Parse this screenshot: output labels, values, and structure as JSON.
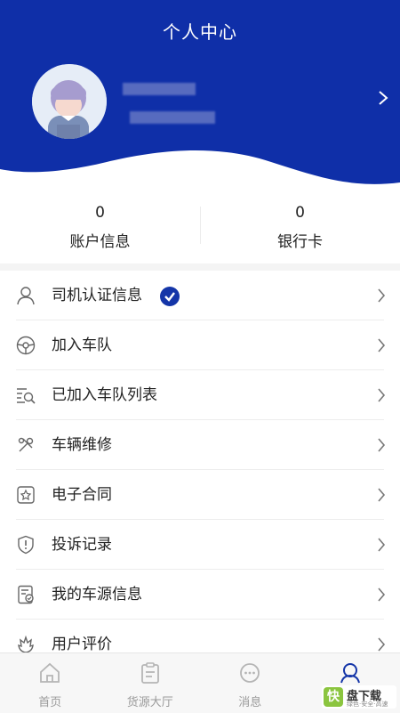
{
  "header": {
    "title": "个人中心",
    "background_color": "#0f2fa8",
    "chevron_icon": "chevron-right-icon"
  },
  "stats": [
    {
      "value": "0",
      "label": "账户信息"
    },
    {
      "value": "0",
      "label": "银行卡"
    }
  ],
  "menu": [
    {
      "label": "司机认证信息",
      "icon": "user-icon",
      "verified": true
    },
    {
      "label": "加入车队",
      "icon": "steering-wheel-icon"
    },
    {
      "label": "已加入车队列表",
      "icon": "list-search-icon"
    },
    {
      "label": "车辆维修",
      "icon": "wrench-icon"
    },
    {
      "label": "电子合同",
      "icon": "contract-icon"
    },
    {
      "label": "投诉记录",
      "icon": "shield-alert-icon"
    },
    {
      "label": "我的车源信息",
      "icon": "document-check-icon"
    },
    {
      "label": "用户评价",
      "icon": "flower-icon"
    }
  ],
  "tabbar": [
    {
      "label": "首页",
      "icon": "home-icon",
      "active": false
    },
    {
      "label": "货源大厅",
      "icon": "clipboard-icon",
      "active": false
    },
    {
      "label": "消息",
      "icon": "chat-icon",
      "active": false
    },
    {
      "label": "",
      "icon": "person-icon",
      "active": true
    }
  ],
  "watermark": {
    "logo_char": "快",
    "text": "盘下载",
    "subtext": "绿色·安全·高速"
  },
  "colors": {
    "accent": "#1435a8",
    "tab_inactive": "#9a9a9a"
  }
}
